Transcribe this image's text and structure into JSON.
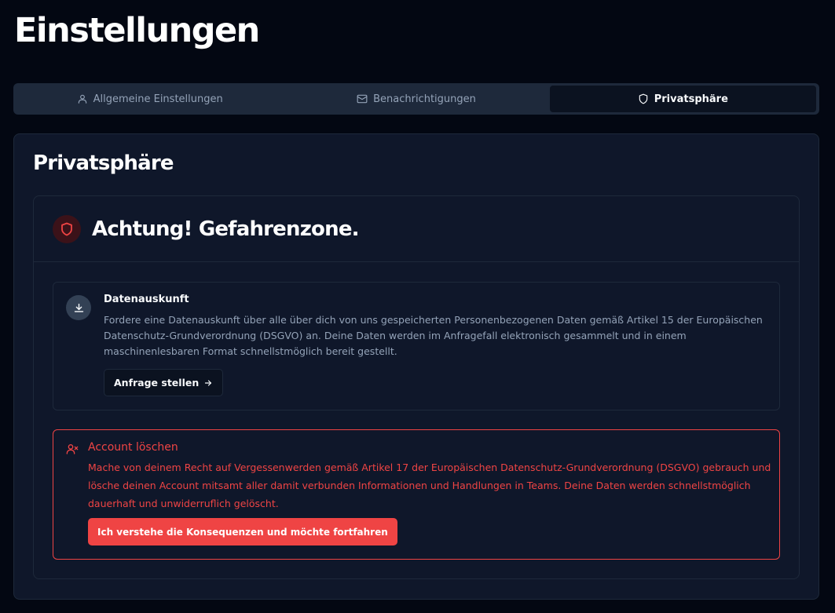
{
  "page": {
    "title": "Einstellungen"
  },
  "tabs": [
    {
      "label": "Allgemeine Einstellungen",
      "icon": "user-icon",
      "active": false
    },
    {
      "label": "Benachrichtigungen",
      "icon": "mail-icon",
      "active": false
    },
    {
      "label": "Privatsphäre",
      "icon": "shield-icon",
      "active": true
    }
  ],
  "card": {
    "title": "Privatsphäre"
  },
  "danger_zone": {
    "title": "Achtung! Gefahrenzone.",
    "export": {
      "title": "Datenauskunft",
      "description": "Fordere eine Datenauskunft über alle über dich von uns gespeicherten Personenbezogenen Daten gemäß Artikel 15 der Europäischen Datenschutz-Grundverordnung (DSGVO) an. Deine Daten werden im Anfragefall elektronisch gesammelt und in einem maschinenlesbaren Format schnellstmöglich bereit gestellt.",
      "button_label": "Anfrage stellen"
    },
    "delete": {
      "title": "Account löschen",
      "description": "Mache von deinem Recht auf Vergessenwerden gemäß Artikel 17 der Europäischen Datenschutz-Grundverordnung (DSGVO) gebrauch und lösche deinen Account mitsamt aller damit verbunden Informationen und Handlungen in Teams. Deine Daten werden schnellstmöglich dauerhaft und unwiderruflich gelöscht.",
      "button_label": "Ich verstehe die Konsequenzen und möchte fortfahren"
    }
  },
  "colors": {
    "background": "#030712",
    "card": "#0f172a",
    "danger": "#ef4444",
    "muted_text": "#94a3b8"
  }
}
